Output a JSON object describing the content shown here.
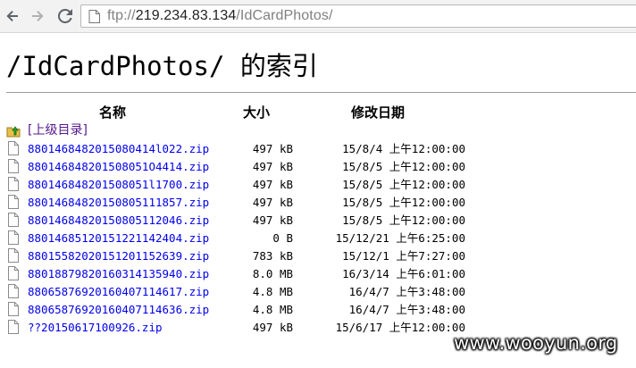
{
  "browser": {
    "url_scheme": "ftp://",
    "url_host": "219.234.83.134",
    "url_path": "/IdCardPhotos/"
  },
  "page": {
    "title": "/IdCardPhotos/ 的索引",
    "columns": {
      "name": "名称",
      "size": "大小",
      "date": "修改日期"
    },
    "parent_link": "[上级目录]",
    "files": [
      {
        "name": "8801468482015080414l022.zip",
        "size": "497 kB",
        "date": "15/8/4 上午12:00:00"
      },
      {
        "name": "880146848201508051O4414.zip",
        "size": "497 kB",
        "date": "15/8/5 上午12:00:00"
      },
      {
        "name": "880146848201508051l1700.zip",
        "size": "497 kB",
        "date": "15/8/5 上午12:00:00"
      },
      {
        "name": "88014684820150805111857.zip",
        "size": "497 kB",
        "date": "15/8/5 上午12:00:00"
      },
      {
        "name": "88014684820150805112046.zip",
        "size": "497 kB",
        "date": "15/8/5 上午12:00:00"
      },
      {
        "name": "88014685120151221142404.zip",
        "size": "0 B",
        "date": "15/12/21 上午6:25:00"
      },
      {
        "name": "88015582020151201152639.zip",
        "size": "783 kB",
        "date": "15/12/1 上午7:27:00"
      },
      {
        "name": "88018879820160314135940.zip",
        "size": "8.0 MB",
        "date": "16/3/14 上午6:01:00"
      },
      {
        "name": "88065876920160407114617.zip",
        "size": "4.8 MB",
        "date": "16/4/7 上午3:48:00"
      },
      {
        "name": "88065876920160407114636.zip",
        "size": "4.8 MB",
        "date": "16/4/7 上午3:48:00"
      },
      {
        "name": "??20150617100926.zip",
        "size": "497 kB",
        "date": "15/6/17 上午12:00:00"
      }
    ]
  },
  "watermark": "www.wooyun.org",
  "icons": {
    "back": "back-arrow-icon",
    "forward": "forward-arrow-icon",
    "reload": "reload-icon",
    "page": "page-icon",
    "folder_up": "folder-up-icon",
    "file": "file-icon"
  },
  "colors": {
    "link": "#0000ee",
    "visited_link": "#551a8b",
    "toolbar": "#f2f2f2",
    "url_dim": "#808080"
  }
}
